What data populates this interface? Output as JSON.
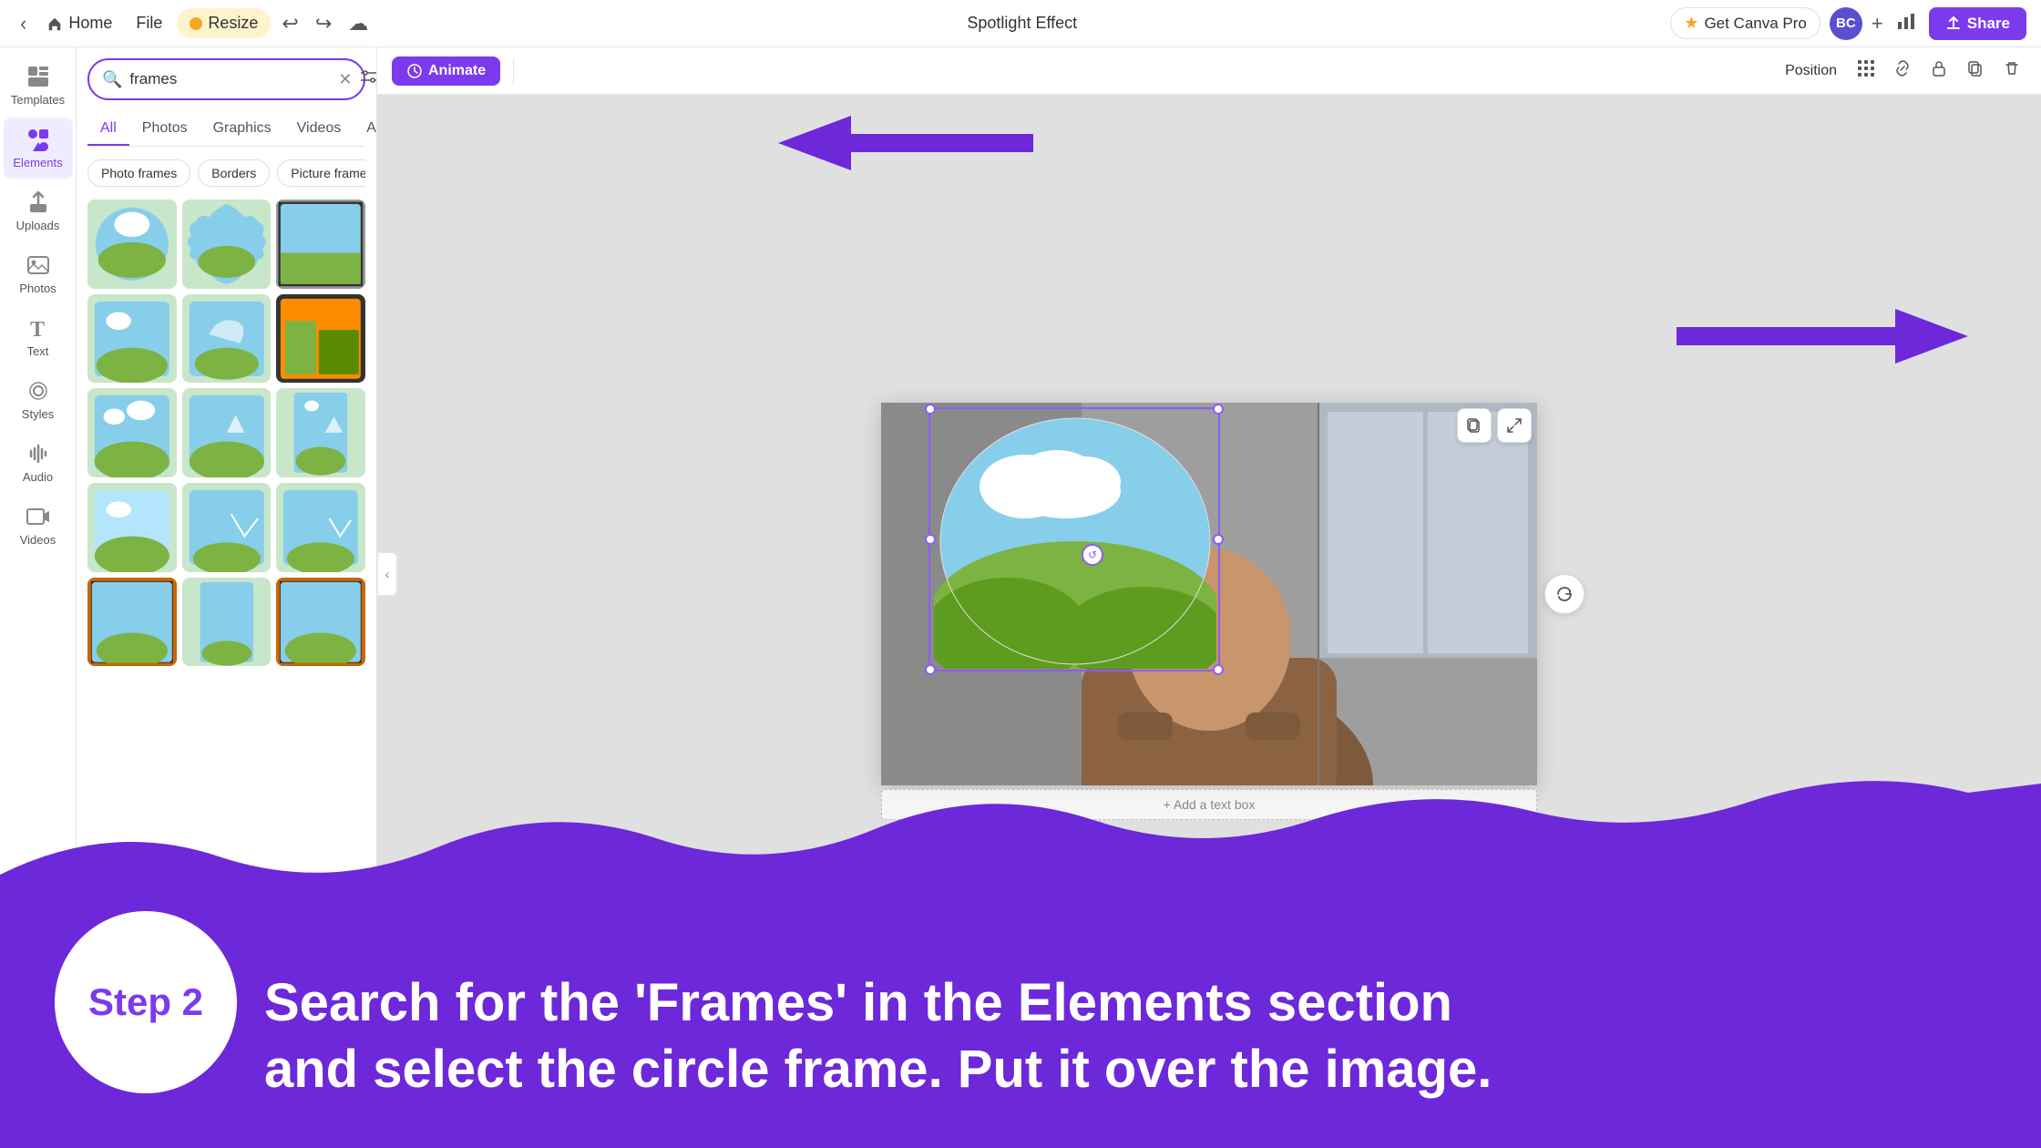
{
  "topbar": {
    "home_label": "Home",
    "file_label": "File",
    "resize_label": "Resize",
    "undo_icon": "↩",
    "redo_icon": "↪",
    "cloud_icon": "☁",
    "project_title": "Spotlight Effect",
    "canva_pro_label": "Get Canva Pro",
    "avatar_initials": "BC",
    "share_label": "Share",
    "share_icon": "↑"
  },
  "toolbar_top": {
    "animate_label": "Animate",
    "position_label": "Position"
  },
  "sidebar": {
    "items": [
      {
        "id": "templates",
        "icon": "⊞",
        "label": "Templates"
      },
      {
        "id": "elements",
        "icon": "✦",
        "label": "Elements"
      },
      {
        "id": "uploads",
        "icon": "↑",
        "label": "Uploads"
      },
      {
        "id": "photos",
        "icon": "🖼",
        "label": "Photos"
      },
      {
        "id": "text",
        "icon": "T",
        "label": "Text"
      },
      {
        "id": "styles",
        "icon": "◉",
        "label": "Styles"
      },
      {
        "id": "audio",
        "icon": "♪",
        "label": "Audio"
      },
      {
        "id": "videos",
        "icon": "▶",
        "label": "Videos"
      }
    ]
  },
  "search_panel": {
    "search_placeholder": "frames",
    "search_value": "frames",
    "tabs": [
      "All",
      "Photos",
      "Graphics",
      "Videos",
      "Audio"
    ],
    "active_tab": "All",
    "chips": [
      "Photo frames",
      "Borders",
      "Picture frames"
    ],
    "clear_tooltip": "Clear",
    "filter_tooltip": "Filters"
  },
  "bottom": {
    "step_label": "Step 2",
    "instruction_line1": "Search for the 'Frames' in the Elements section",
    "instruction_line2": "and select the circle frame. Put it over the image."
  },
  "canvas": {
    "add_text": "+ Add a text box"
  },
  "colors": {
    "purple": "#7c3aed",
    "light_purple": "#8b5cf6",
    "wave_purple": "#6d28d9"
  }
}
